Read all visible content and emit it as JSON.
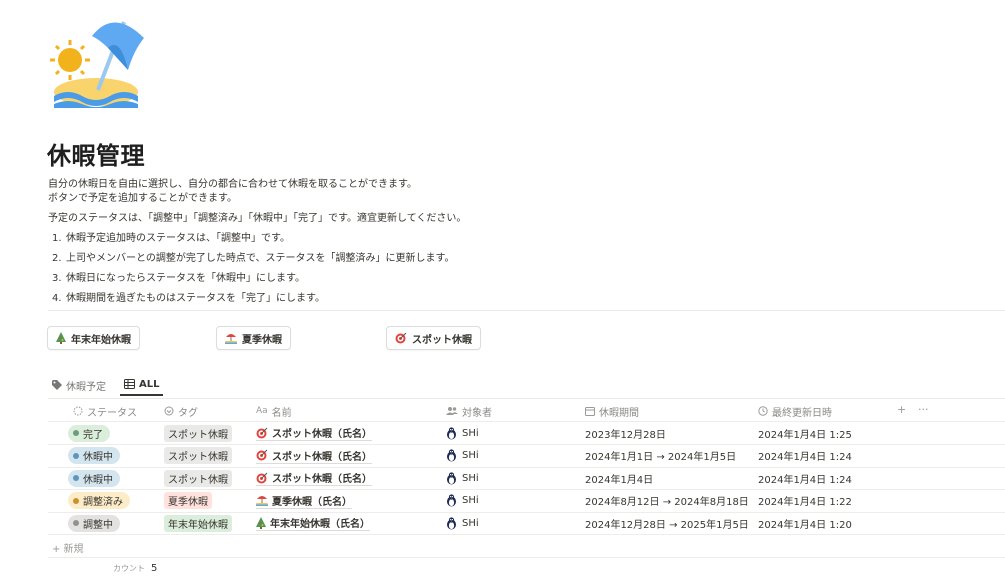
{
  "page": {
    "icon": "beach-umbrella-icon",
    "title": "休暇管理",
    "description": [
      "自分の休暇日を自由に選択し、自分の都合に合わせて休暇を取ることができます。",
      "ボタンで予定を追加することができます。",
      "予定のステータスは、「調整中」「調整済み」「休暇中」「完了」です。適宜更新してください。"
    ],
    "steps": [
      {
        "num": "1.",
        "text": "休暇予定追加時のステータスは、「調整中」です。"
      },
      {
        "num": "2.",
        "text": "上司やメンバーとの調整が完了した時点で、ステータスを「調整済み」に更新します。"
      },
      {
        "num": "3.",
        "text": "休暇日になったらステータスを「休暇中」にします。"
      },
      {
        "num": "4.",
        "text": "休暇期間を過ぎたものはステータスを「完了」にします。"
      }
    ]
  },
  "template_buttons": [
    {
      "icon": "christmas-tree-icon",
      "label": "年末年始休暇"
    },
    {
      "icon": "beach-icon",
      "label": "夏季休暇"
    },
    {
      "icon": "dart-icon",
      "label": "スポット休暇"
    }
  ],
  "views": [
    {
      "icon": "tag-icon",
      "label": "休暇予定",
      "active": false
    },
    {
      "icon": "table-icon",
      "label": "ALL",
      "active": true
    }
  ],
  "columns": [
    {
      "icon": "status-icon",
      "label": "ステータス"
    },
    {
      "icon": "multi-select-icon",
      "label": "タグ"
    },
    {
      "icon": "text-icon",
      "icon_glyph": "Aa",
      "label": "名前"
    },
    {
      "icon": "people-icon",
      "label": "対象者"
    },
    {
      "icon": "calendar-icon",
      "label": "休暇期間"
    },
    {
      "icon": "clock-icon",
      "label": "最終更新日時"
    }
  ],
  "header_controls": {
    "add": "+",
    "more": "···"
  },
  "rows": [
    {
      "status": "完了",
      "status_bg": "#dbeddb",
      "status_dot": "#6c9b7d",
      "tag": "スポット休暇",
      "tag_bg": "#e9e9e7",
      "name_icon": "dart-icon",
      "name": "スポット休暇（氏名）",
      "person": "SHi",
      "period": "2023年12月28日",
      "updated": "2024年1月4日 1:25"
    },
    {
      "status": "休暇中",
      "status_bg": "#d3e5ef",
      "status_dot": "#5b97bd",
      "tag": "スポット休暇",
      "tag_bg": "#e9e9e7",
      "name_icon": "dart-icon",
      "name": "スポット休暇（氏名）",
      "person": "SHi",
      "period": "2024年1月1日 → 2024年1月5日",
      "updated": "2024年1月4日 1:24"
    },
    {
      "status": "休暇中",
      "status_bg": "#d3e5ef",
      "status_dot": "#5b97bd",
      "tag": "スポット休暇",
      "tag_bg": "#e9e9e7",
      "name_icon": "dart-icon",
      "name": "スポット休暇（氏名）",
      "person": "SHi",
      "period": "2024年1月4日",
      "updated": "2024年1月4日 1:24"
    },
    {
      "status": "調整済み",
      "status_bg": "#fdecc8",
      "status_dot": "#cb912f",
      "tag": "夏季休暇",
      "tag_bg": "#ffe2dd",
      "name_icon": "beach-icon",
      "name": "夏季休暇（氏名）",
      "person": "SHi",
      "period": "2024年8月12日 → 2024年8月18日",
      "updated": "2024年1月4日 1:22"
    },
    {
      "status": "調整中",
      "status_bg": "#e3e2e0",
      "status_dot": "#91918e",
      "tag": "年末年始休暇",
      "tag_bg": "#dbeddb",
      "name_icon": "christmas-tree-icon",
      "name": "年末年始休暇（氏名）",
      "person": "SHi",
      "period": "2024年12月28日 → 2025年1月5日",
      "updated": "2024年1月4日 1:20"
    }
  ],
  "new_row": "+ 新規",
  "footer": {
    "count_label": "カウント",
    "count_value": "5"
  }
}
